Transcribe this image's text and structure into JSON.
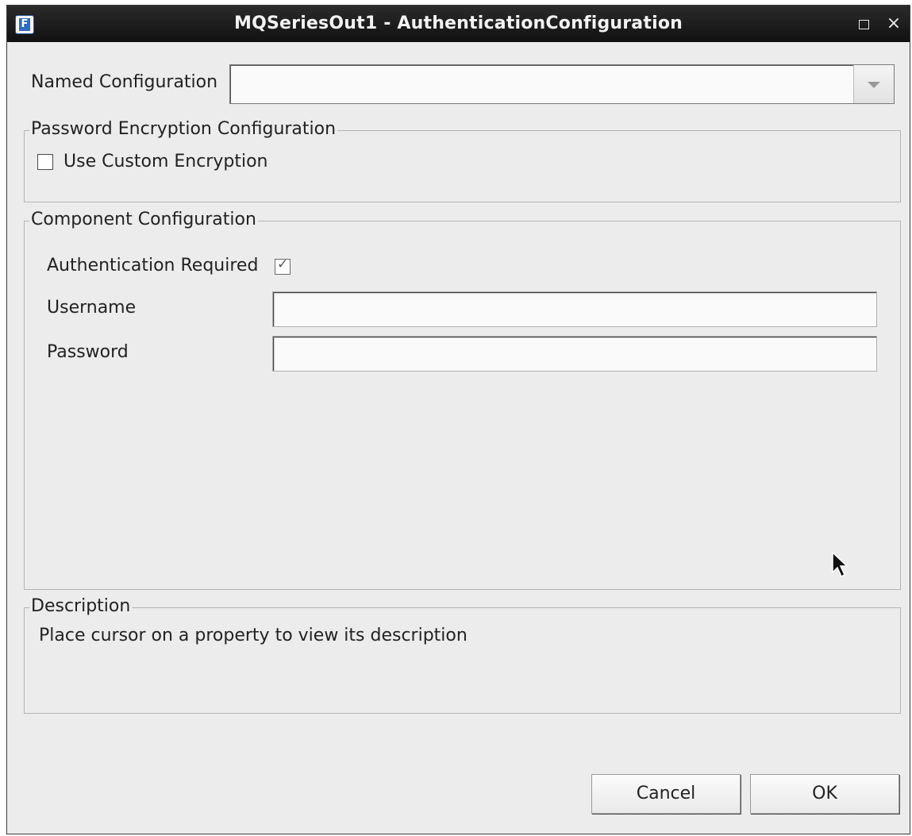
{
  "window": {
    "title": "MQSeriesOut1 - AuthenticationConfiguration",
    "app_icon_letter": "F",
    "maximize_label": "",
    "close_label": "×"
  },
  "named_configuration": {
    "label": "Named Configuration",
    "value": ""
  },
  "password_encryption": {
    "group_title": "Password Encryption Configuration",
    "use_custom_encryption_label": "Use Custom Encryption",
    "use_custom_encryption_checked": false
  },
  "component_configuration": {
    "group_title": "Component Configuration",
    "authentication_required_label": "Authentication Required",
    "authentication_required_checked": true,
    "username_label": "Username",
    "username_value": "",
    "password_label": "Password",
    "password_value": ""
  },
  "description": {
    "group_title": "Description",
    "text": "Place cursor on a property to view its description"
  },
  "buttons": {
    "cancel": "Cancel",
    "ok": "OK"
  },
  "icons": {
    "app": "app-icon",
    "maximize": "maximize-icon",
    "close": "close-icon",
    "dropdown": "chevron-down-icon",
    "cursor": "mouse-pointer-icon"
  }
}
